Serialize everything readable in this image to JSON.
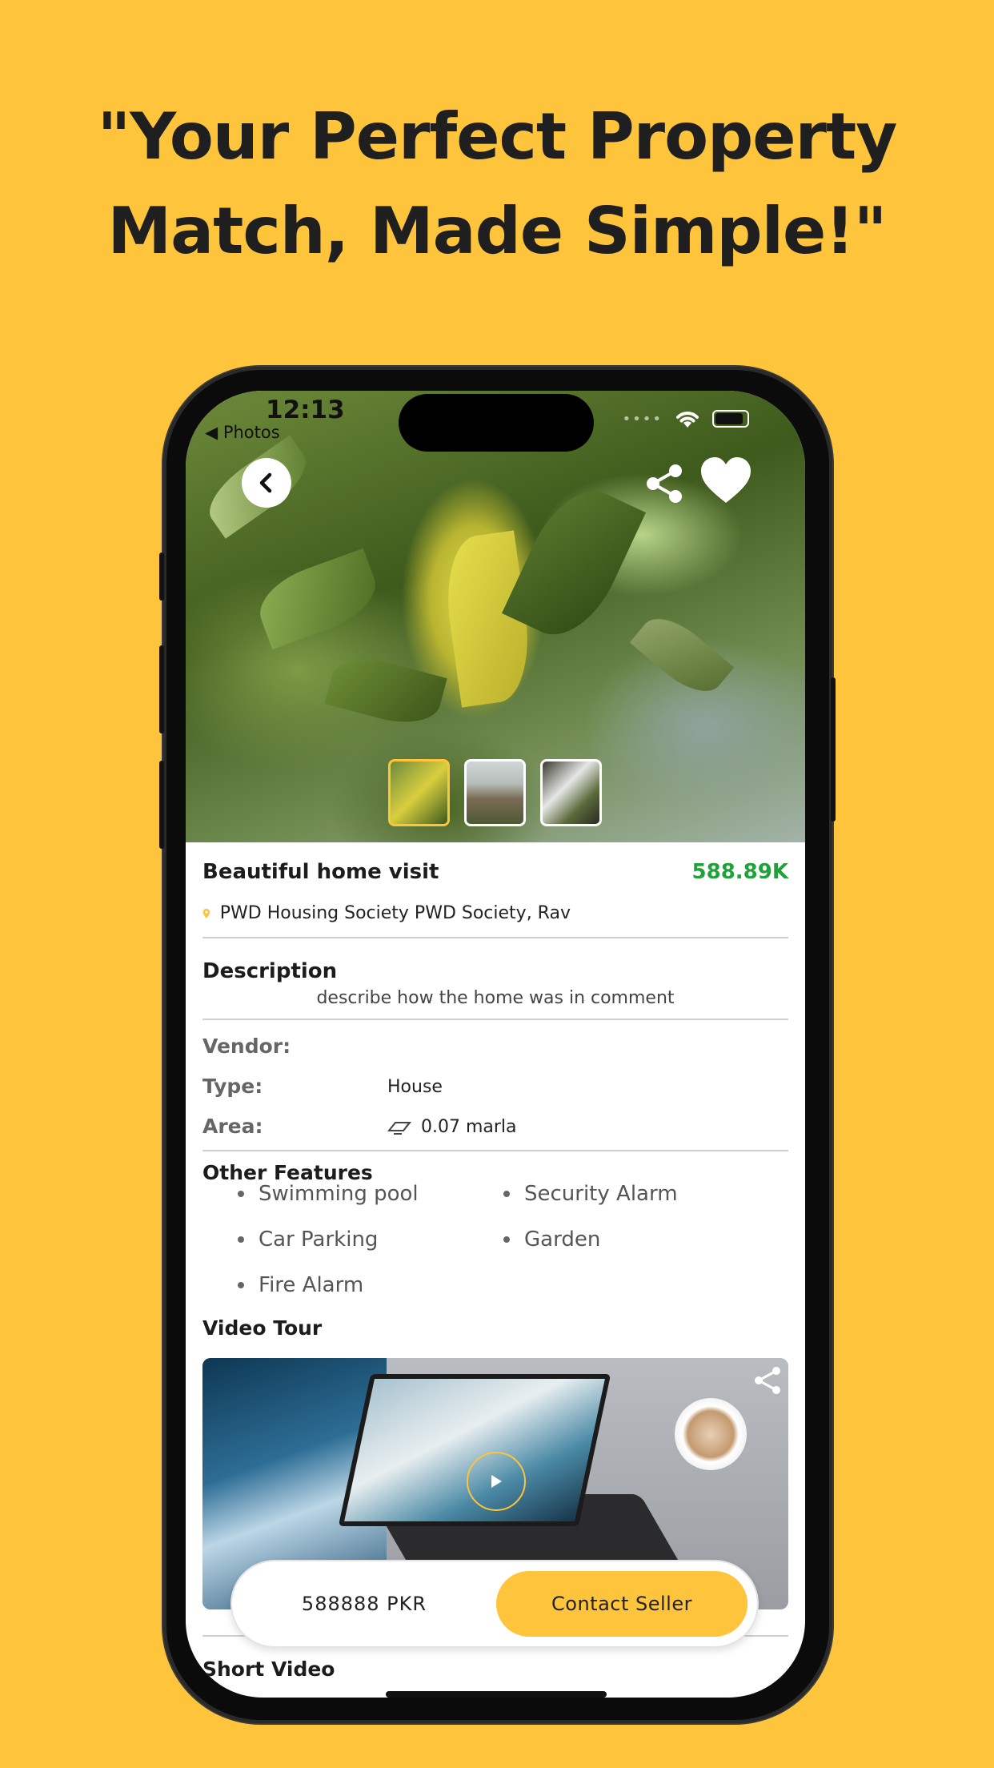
{
  "headline": {
    "line1": "\"Your Perfect Property",
    "line2": "Match, Made Simple!\""
  },
  "status_bar": {
    "time": "12:13",
    "back_app": "◀ Photos"
  },
  "listing": {
    "title": "Beautiful home visit",
    "price": "588.89K",
    "location": "PWD Housing Society PWD Society, Rav"
  },
  "description": {
    "heading": "Description",
    "text": "describe how the home was in comment"
  },
  "details": {
    "vendor_label": "Vendor:",
    "vendor_value": "",
    "type_label": "Type:",
    "type_value": "House",
    "area_label": "Area:",
    "area_value": "0.07 marla"
  },
  "features": {
    "heading": "Other Features",
    "items": [
      "Swimming pool",
      "Security Alarm",
      "Car Parking",
      "Garden",
      "Fire Alarm"
    ]
  },
  "video_tour": {
    "heading": "Video Tour"
  },
  "short_video": {
    "heading": "Short Video"
  },
  "bottom_bar": {
    "price": "588888 PKR",
    "contact_label": "Contact Seller"
  },
  "colors": {
    "brand_yellow": "#FDC43C",
    "price_green": "#1fa23a"
  },
  "icons": [
    "chevron-left-icon",
    "share-icon",
    "heart-icon",
    "location-pin-icon",
    "ruler-icon",
    "play-icon",
    "wifi-icon",
    "battery-icon"
  ]
}
